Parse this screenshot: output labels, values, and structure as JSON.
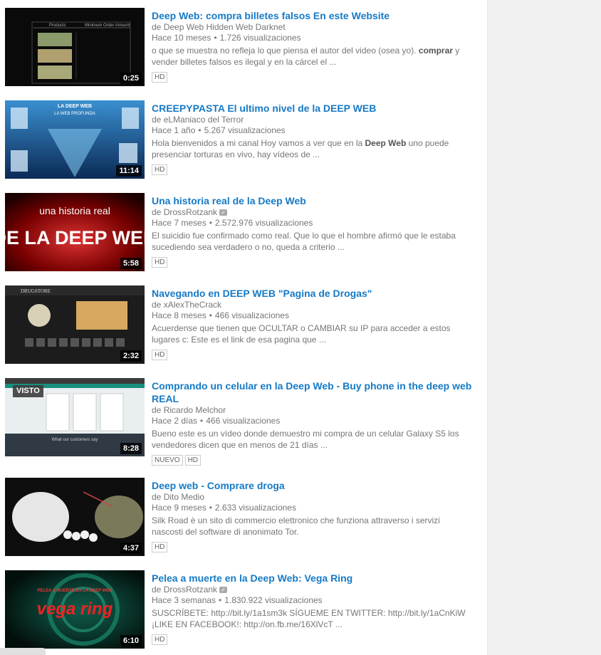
{
  "videos": [
    {
      "title": "Deep Web: compra billetes falsos En este Website",
      "channel_prefix": "de",
      "channel": "Deep Web Hidden Web Darknet",
      "verified": false,
      "age": "Hace 10 meses",
      "views": "1.726 visualizaciones",
      "desc_parts": [
        "o que se muestra no refleja lo que piensa el autor del video (osea yo). ",
        "comprar",
        " y vender billetes falsos es ilegal y en la cárcel el ..."
      ],
      "duration": "0:25",
      "badges": [
        "HD"
      ],
      "thumb_text": [
        "Products",
        "Minimum Order Amount"
      ]
    },
    {
      "title": "CREEPYPASTA El ultimo nivel de la DEEP WEB",
      "channel_prefix": "de",
      "channel": "eLManiaco del Terror",
      "verified": false,
      "age": "Hace 1 año",
      "views": "5.267 visualizaciones",
      "desc_parts": [
        "Hola bienvenidos a mi canal Hoy vamos a ver que en la ",
        "Deep Web",
        " uno puede presenciar torturas en vivo, hay vídeos de ..."
      ],
      "duration": "11:14",
      "badges": [
        "HD"
      ],
      "thumb_text": [
        "LA DEEP WEB",
        "LA WEB PROFUNDA"
      ]
    },
    {
      "title": "Una historia real de la Deep Web",
      "channel_prefix": "de",
      "channel": "DrossRotzank",
      "verified": true,
      "age": "Hace 7 meses",
      "views": "2.572.976 visualizaciones",
      "desc_parts": [
        "El suicidio fue confirmado como real. Que lo que el hombre afirmó que le estaba sucediendo sea verdadero o no, queda a criterio ...",
        "",
        ""
      ],
      "duration": "5:58",
      "badges": [
        "HD"
      ],
      "thumb_text": [
        "una historia real",
        "DE LA DEEP WEB"
      ]
    },
    {
      "title": "Navegando en DEEP WEB \"Pagina de Drogas\"",
      "channel_prefix": "de",
      "channel": "xAlexTheCrack",
      "verified": false,
      "age": "Hace 8 meses",
      "views": "466 visualizaciones",
      "desc_parts": [
        "Acuerdense que tienen que OCULTAR o CAMBIAR su IP para acceder a estos lugares c: Este es el link de esa pagina que ...",
        "",
        ""
      ],
      "duration": "2:32",
      "badges": [
        "HD"
      ],
      "thumb_text": [
        "DRUGSTORE",
        ""
      ]
    },
    {
      "title": "Comprando un celular en la Deep Web - Buy phone in the deep web REAL",
      "channel_prefix": "de",
      "channel": "Ricardo Melchor",
      "verified": false,
      "age": "Hace 2 días",
      "views": "466 visualizaciones",
      "desc_parts": [
        "Bueno este es un vídeo donde demuestro mi compra de un celular Galaxy S5 los vendedores dicen que en menos de 21 días ...",
        "",
        ""
      ],
      "duration": "8:28",
      "watched_label": "VISTO",
      "badges": [
        "NUEVO",
        "HD"
      ],
      "thumb_text": [
        "What our customers say",
        ""
      ]
    },
    {
      "title": "Deep web - Comprare droga",
      "channel_prefix": "de",
      "channel": "Dito Medio",
      "verified": false,
      "age": "Hace 9 meses",
      "views": "2.633 visualizaciones",
      "desc_parts": [
        "Silk Road è un sito di commercio elettronico che funziona attraverso i servizi nascosti del software di anonimato Tor.",
        "",
        ""
      ],
      "duration": "4:37",
      "badges": [
        "HD"
      ],
      "thumb_text": [
        "",
        ""
      ]
    },
    {
      "title": "Pelea a muerte en la Deep Web: Vega Ring",
      "channel_prefix": "de",
      "channel": "DrossRotzank",
      "verified": true,
      "age": "Hace 3 semanas",
      "views": "1.830.922 visualizaciones",
      "desc_parts": [
        "SUSCRÍBETE: http://bit.ly/1a1sm3k SÍGUEME EN TWITTER: http://bit.ly/1aCnKiW ¡LIKE EN FACEBOOK!: http://on.fb.me/16XlVcT ...",
        "",
        ""
      ],
      "duration": "6:10",
      "badges": [
        "HD"
      ],
      "thumb_text": [
        "PELEA A MUERTE EN LA DEEP WEB",
        "vega ring"
      ]
    }
  ],
  "colors": {
    "title": "#167ac6",
    "meta": "#767676"
  }
}
